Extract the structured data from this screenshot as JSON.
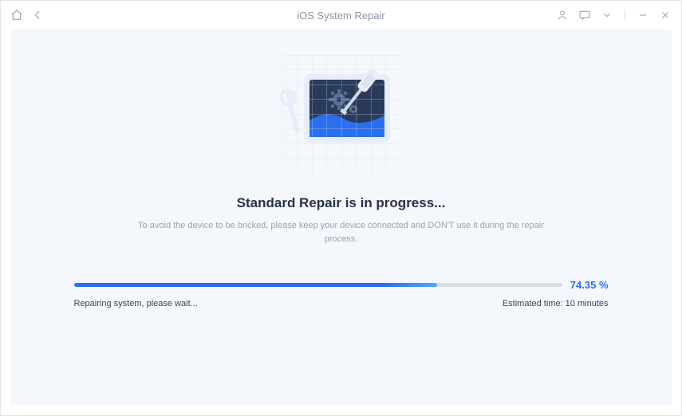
{
  "titlebar": {
    "title": "iOS System Repair"
  },
  "main": {
    "heading": "Standard Repair is in progress...",
    "subtext": "To avoid the device to be bricked, please keep your device connected and DON'T use it during the repair process."
  },
  "progress": {
    "percent_value": 74.35,
    "percent_label": "74.35 %",
    "status_text": "Repairing system, please wait...",
    "estimated_label": "Estimated time: 10 minutes"
  },
  "colors": {
    "accent": "#2a6ff0",
    "panel_bg": "#f4f7fb"
  }
}
